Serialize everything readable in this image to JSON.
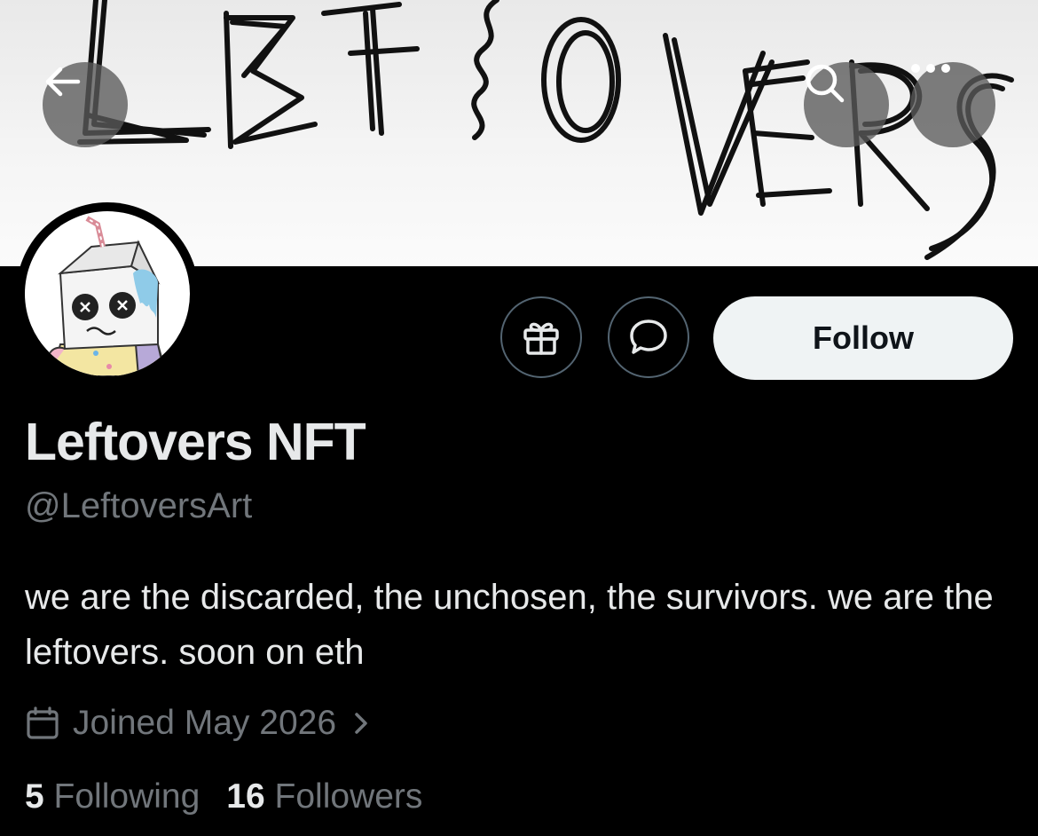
{
  "banner": {
    "text": "LEFTOVERS"
  },
  "profile": {
    "display_name": "Leftovers NFT",
    "handle": "@LeftoversArt",
    "bio": "we are the discarded, the unchosen, the survivors. we are the leftovers. soon on eth",
    "joined": "Joined May 2026"
  },
  "actions": {
    "follow_label": "Follow"
  },
  "stats": {
    "following_count": "5",
    "following_label": "Following",
    "followers_count": "16",
    "followers_label": "Followers"
  },
  "icons": {
    "back": "arrow-left-icon",
    "search": "search-icon",
    "more": "more-icon",
    "gift": "gift-icon",
    "message": "message-bubble-icon",
    "calendar": "calendar-icon",
    "chevron": "chevron-right-icon"
  },
  "colors": {
    "background": "#000000",
    "text_primary": "#e7e9ea",
    "text_secondary": "#71767b",
    "follow_button": "#eff3f4"
  }
}
